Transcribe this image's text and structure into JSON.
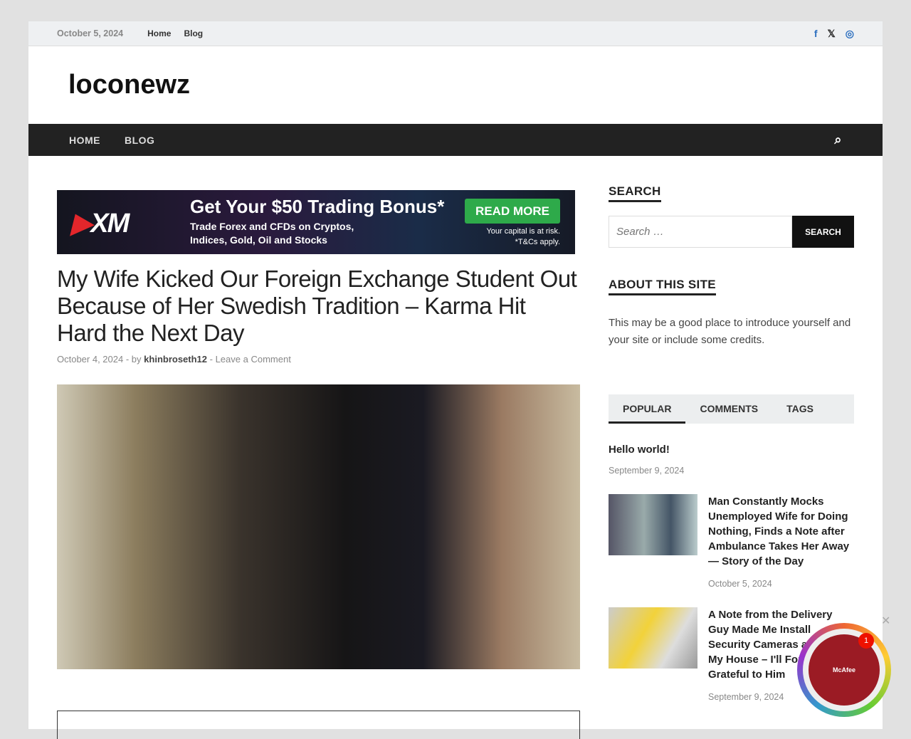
{
  "topbar": {
    "date": "October 5, 2024",
    "links": [
      "Home",
      "Blog"
    ]
  },
  "site": {
    "title": "loconewz"
  },
  "nav": {
    "items": [
      "HOME",
      "BLOG"
    ]
  },
  "ad": {
    "brand": "XM",
    "headline": "Get Your $50 Trading Bonus*",
    "sub1": "Trade Forex and CFDs on Cryptos,",
    "sub2": "Indices, Gold, Oil and Stocks",
    "button": "READ MORE",
    "risk1": "Your capital is at risk.",
    "risk2": "*T&Cs apply."
  },
  "article": {
    "title": "My Wife Kicked Our Foreign Exchange Student Out Because of Her Swedish Tradition – Karma Hit Hard the Next Day",
    "date": "October 4, 2024",
    "by": "by",
    "author": "khinbroseth12",
    "comments": "Leave a Comment"
  },
  "sidebar": {
    "search_title": "SEARCH",
    "search_placeholder": "Search …",
    "search_button": "SEARCH",
    "about_title": "ABOUT THIS SITE",
    "about_text": "This may be a good place to introduce yourself and your site or include some credits.",
    "tabs": [
      "POPULAR",
      "COMMENTS",
      "TAGS"
    ],
    "posts": [
      {
        "title": "Hello world!",
        "date": "September 9, 2024"
      },
      {
        "title": "Man Constantly Mocks Unemployed Wife for Doing Nothing, Finds a Note after Ambulance Takes Her Away — Story of the Day",
        "date": "October 5, 2024"
      },
      {
        "title": "A Note from the Delivery Guy Made Me Install Security Cameras around My House – I'll Forever Be Grateful to Him",
        "date": "September 9, 2024"
      }
    ]
  },
  "popup": {
    "brand": "McAfee",
    "badge": "1"
  }
}
